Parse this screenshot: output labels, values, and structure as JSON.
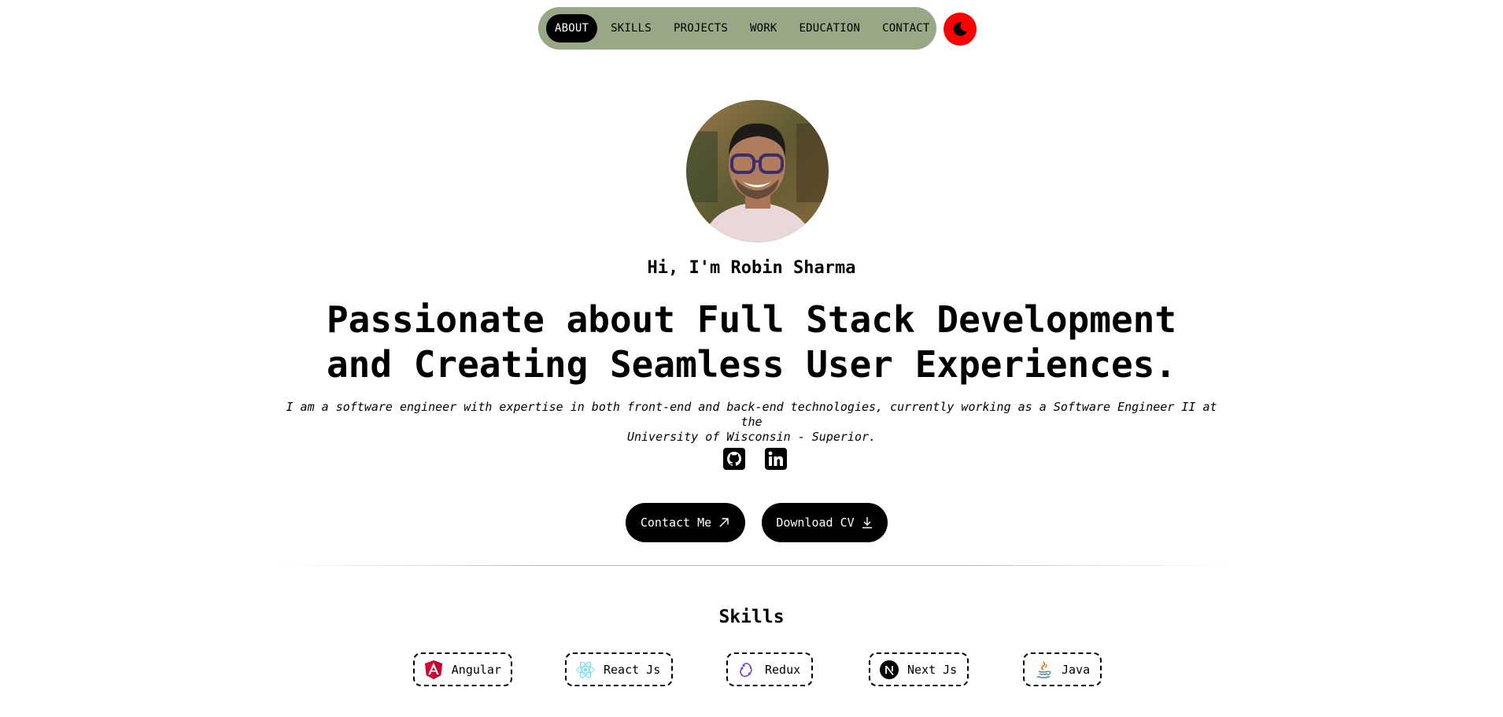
{
  "nav": {
    "items": [
      {
        "label": "ABOUT",
        "active": true
      },
      {
        "label": "SKILLS",
        "active": false
      },
      {
        "label": "PROJECTS",
        "active": false
      },
      {
        "label": "WORK",
        "active": false
      },
      {
        "label": "EDUCATION",
        "active": false
      },
      {
        "label": "CONTACT",
        "active": false
      }
    ],
    "background_color": "#98a886",
    "theme_toggle": {
      "icon": "moon-icon",
      "color": "#ff0000"
    }
  },
  "hero": {
    "greeting": "Hi, I'm Robin Sharma",
    "headline_line1": "Passionate about Full Stack Development",
    "headline_line2": "and Creating Seamless User Experiences.",
    "bio_line1": "I am a software engineer with expertise in both front-end and back-end technologies, currently working as a Software Engineer II at the",
    "bio_line2": "University of Wisconsin - Superior.",
    "socials": [
      {
        "icon": "github-icon"
      },
      {
        "icon": "linkedin-icon"
      }
    ],
    "contact_button": {
      "label": "Contact Me",
      "icon": "arrow-up-right-icon"
    },
    "cv_button": {
      "label": "Download CV",
      "icon": "download-icon"
    }
  },
  "skills": {
    "title": "Skills",
    "items": [
      {
        "label": "Angular",
        "icon": "angular-icon"
      },
      {
        "label": "React Js",
        "icon": "react-icon"
      },
      {
        "label": "Redux",
        "icon": "redux-icon"
      },
      {
        "label": "Next Js",
        "icon": "nextjs-icon"
      },
      {
        "label": "Java",
        "icon": "java-icon"
      }
    ]
  }
}
